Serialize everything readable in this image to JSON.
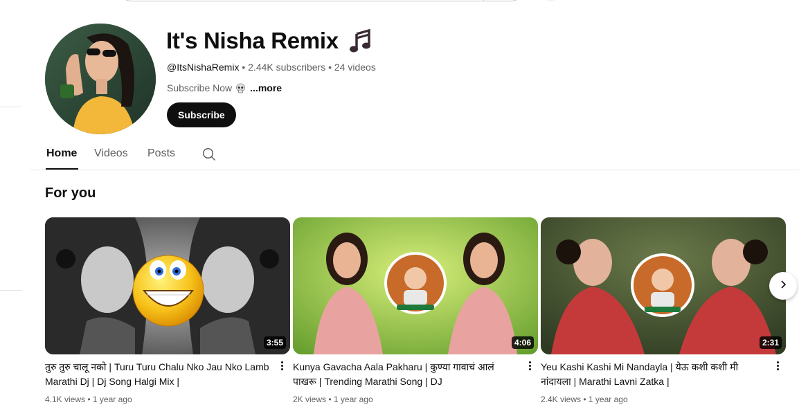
{
  "channel": {
    "name": "It's Nisha Remix",
    "handle": "@ItsNishaRemix",
    "subscribers": "2.44K subscribers",
    "videos": "24 videos",
    "description": "Subscribe Now",
    "more_label": "...more",
    "subscribe_label": "Subscribe",
    "title_icon": "music-notes-icon",
    "desc_icon": "skull-icon"
  },
  "tabs": [
    {
      "label": "Home",
      "active": true
    },
    {
      "label": "Videos",
      "active": false
    },
    {
      "label": "Posts",
      "active": false
    }
  ],
  "section": {
    "title": "For you"
  },
  "videos": [
    {
      "title": "तुरु तुरु चालू नको | Turu Turu Chalu Nko Jau Nko Lamb Marathi Dj | Dj Song Halgi Mix |",
      "duration": "3:55",
      "views": "4.1K views",
      "age": "1 year ago"
    },
    {
      "title": "Kunya Gavacha Aala Pakharu | कुण्या गावाचं आलं पाखरू | Trending Marathi Song | DJ",
      "duration": "4:06",
      "views": "2K views",
      "age": "1 year ago"
    },
    {
      "title": "Yeu Kashi Kashi Mi Nandayla | येऊ कशी कशी मी नांदायला | Marathi Lavni Zatka |",
      "duration": "2:31",
      "views": "2.4K views",
      "age": "1 year ago"
    }
  ],
  "colors": {
    "text": "#0f0f0f",
    "secondary": "#606060",
    "button": "#0f0f0f"
  }
}
